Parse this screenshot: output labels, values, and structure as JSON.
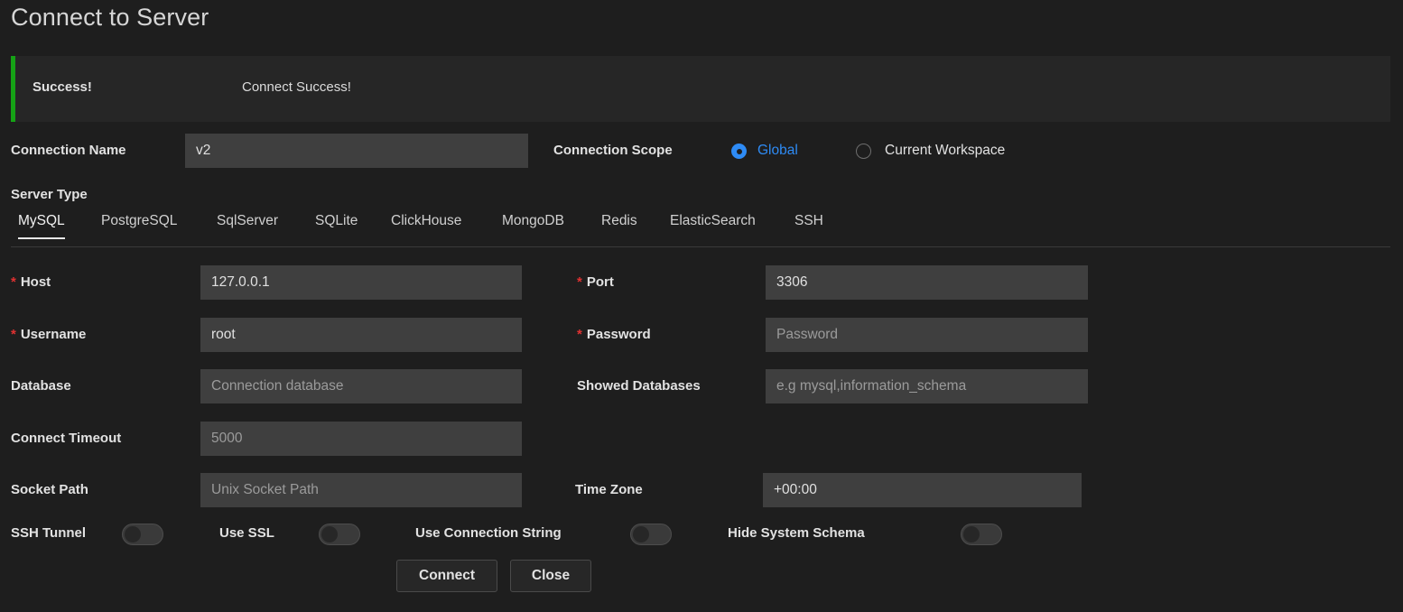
{
  "window": {
    "title": "Connect to Server"
  },
  "banner": {
    "title": "Success!",
    "message": "Connect Success!",
    "accent_color": "#15a215"
  },
  "connection_name": {
    "label": "Connection Name",
    "value": "v2"
  },
  "connection_scope": {
    "label": "Connection Scope",
    "selected": "Global",
    "options": [
      {
        "label": "Global",
        "selected": true
      },
      {
        "label": "Current Workspace",
        "selected": false
      }
    ],
    "accent_color": "#2e8bf5"
  },
  "server_type": {
    "label": "Server Type",
    "active": "MySQL",
    "tabs": [
      {
        "label": "MySQL"
      },
      {
        "label": "PostgreSQL"
      },
      {
        "label": "SqlServer"
      },
      {
        "label": "SQLite"
      },
      {
        "label": "ClickHouse"
      },
      {
        "label": "MongoDB"
      },
      {
        "label": "Redis"
      },
      {
        "label": "ElasticSearch"
      },
      {
        "label": "SSH"
      }
    ]
  },
  "fields": {
    "host": {
      "label": "Host",
      "required": true,
      "value": "127.0.0.1",
      "placeholder": ""
    },
    "port": {
      "label": "Port",
      "required": true,
      "value": "3306",
      "placeholder": ""
    },
    "username": {
      "label": "Username",
      "required": true,
      "value": "root",
      "placeholder": ""
    },
    "password": {
      "label": "Password",
      "required": true,
      "value": "",
      "placeholder": "Password"
    },
    "database": {
      "label": "Database",
      "required": false,
      "value": "",
      "placeholder": "Connection database"
    },
    "showed_databases": {
      "label": "Showed Databases",
      "required": false,
      "value": "",
      "placeholder": "e.g mysql,information_schema"
    },
    "connect_timeout": {
      "label": "Connect Timeout",
      "required": false,
      "value": "",
      "placeholder": "5000"
    },
    "socket_path": {
      "label": "Socket Path",
      "required": false,
      "value": "",
      "placeholder": "Unix Socket Path"
    },
    "time_zone": {
      "label": "Time Zone",
      "required": false,
      "value": "+00:00",
      "placeholder": ""
    }
  },
  "toggles": [
    {
      "label": "SSH Tunnel",
      "on": false
    },
    {
      "label": "Use SSL",
      "on": false
    },
    {
      "label": "Use Connection String",
      "on": false
    },
    {
      "label": "Hide System Schema",
      "on": false
    }
  ],
  "actions": {
    "connect": "Connect",
    "close": "Close"
  },
  "required_marker": "*"
}
